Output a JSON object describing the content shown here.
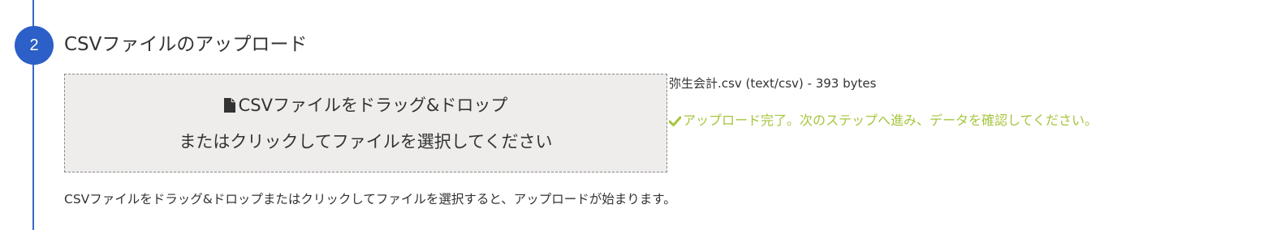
{
  "step": {
    "number": "2",
    "title": "CSVファイルのアップロード"
  },
  "dropzone": {
    "icon": "file-icon",
    "line1": "CSVファイルをドラッグ&ドロップ",
    "line2": "またはクリックしてファイルを選択してください"
  },
  "file": {
    "info": "弥生会計.csv (text/csv) - 393 bytes"
  },
  "status": {
    "icon": "check-icon",
    "message": "アップロード完了。次のステップへ進み、データを確認してください。",
    "color": "#a4c63f"
  },
  "help": {
    "text": "CSVファイルをドラッグ&ドロップまたはクリックしてファイルを選択すると、アップロードが始まります。"
  },
  "colors": {
    "accent": "#2c5fc7",
    "dropzone_bg": "#eeedeb"
  }
}
